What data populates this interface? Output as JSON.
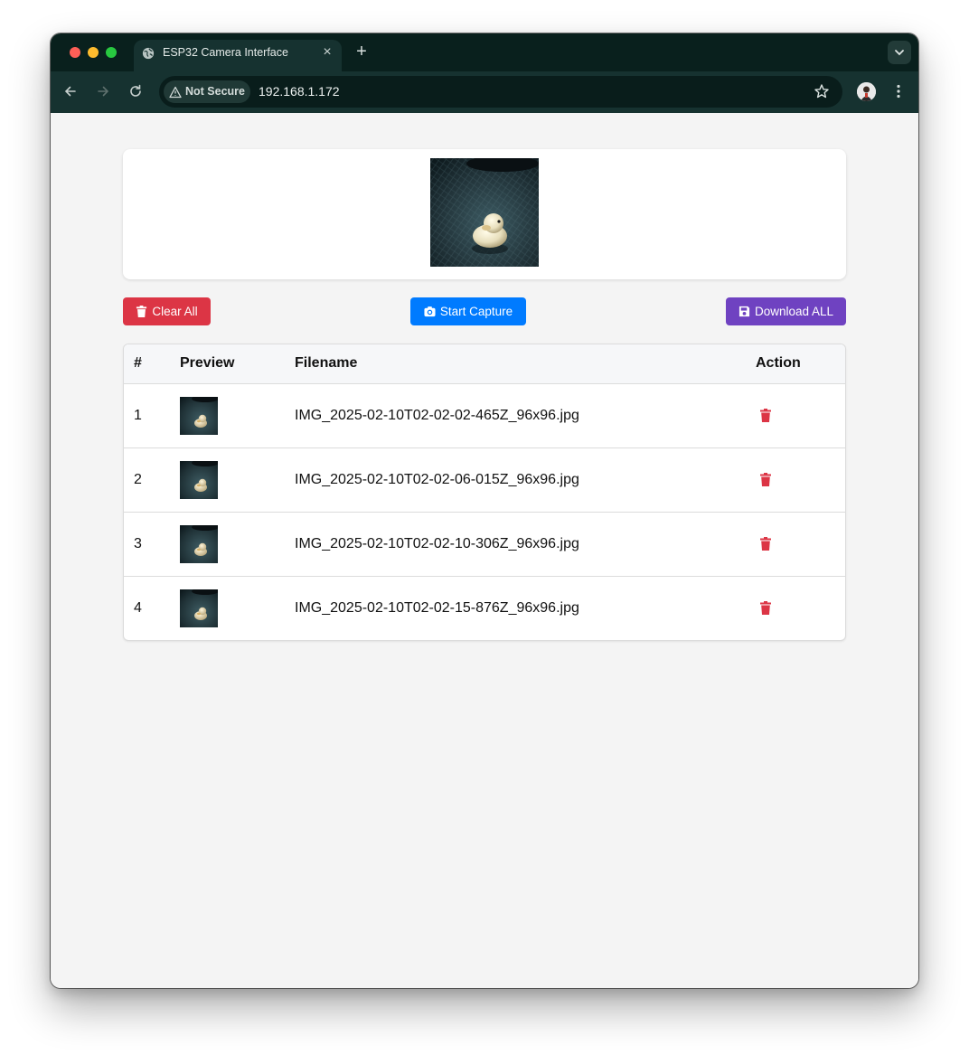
{
  "browser": {
    "tab_title": "ESP32 Camera Interface",
    "new_tab_symbol": "+",
    "close_symbol": "×",
    "security_label": "Not Secure",
    "url": "192.168.1.172"
  },
  "toolbar": {
    "clear_label": "Clear All",
    "capture_label": "Start Capture",
    "download_label": "Download ALL"
  },
  "table": {
    "headers": {
      "num": "#",
      "preview": "Preview",
      "filename": "Filename",
      "action": "Action"
    },
    "rows": [
      {
        "num": "1",
        "filename": "IMG_2025-02-10T02-02-02-465Z_96x96.jpg"
      },
      {
        "num": "2",
        "filename": "IMG_2025-02-10T02-02-06-015Z_96x96.jpg"
      },
      {
        "num": "3",
        "filename": "IMG_2025-02-10T02-02-10-306Z_96x96.jpg"
      },
      {
        "num": "4",
        "filename": "IMG_2025-02-10T02-02-15-876Z_96x96.jpg"
      }
    ]
  },
  "icons": {
    "clear": "trash-icon",
    "capture": "camera-icon",
    "download": "floppy-save-icon",
    "row_action": "trash-icon"
  },
  "colors": {
    "danger": "#dc3545",
    "primary": "#007bff",
    "purple": "#6f42c1",
    "browser_frame": "#09201d"
  }
}
